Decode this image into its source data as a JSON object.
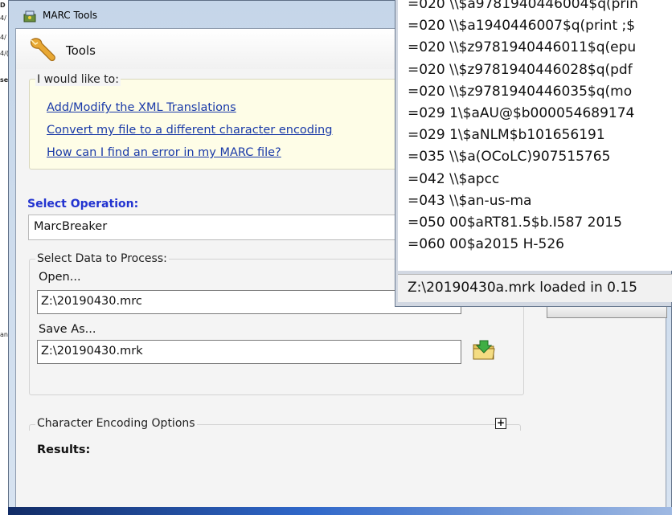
{
  "window": {
    "title": "MARC Tools"
  },
  "header": {
    "title": "Tools"
  },
  "would_like": {
    "legend": "I would like to:",
    "links": [
      "Add/Modify the XML Translations",
      "Convert my file to a different character encoding",
      "How can I find an error in my MARC file?"
    ]
  },
  "operation": {
    "label": "Select Operation:",
    "selected": "MarcBreaker"
  },
  "data": {
    "legend": "Select Data to Process:",
    "open_label": "Open...",
    "open_value": "Z:\\20190430.mrc",
    "save_label": "Save As...",
    "save_value": "Z:\\20190430.mrk"
  },
  "encoding": {
    "legend": "Character Encoding Options",
    "expand_symbol": "+"
  },
  "results": {
    "label": "Results:"
  },
  "record": {
    "lines": [
      "=020  \\\\$a9781940446004$q(prin",
      "=020  \\\\$a1940446007$q(print ;$",
      "=020  \\\\$z9781940446011$q(epu",
      "=020  \\\\$z9781940446028$q(pdf",
      "=020  \\\\$z9781940446035$q(mo",
      "=029  1\\$aAU@$b000054689174",
      "=029  1\\$aNLM$b101656191",
      "=035  \\\\$a(OCoLC)907515765",
      "=042  \\\\$apcc",
      "=043  \\\\$an-us-ma",
      "=050  00$aRT81.5$b.I587 2015",
      "=060  00$a2015 H-526"
    ],
    "status": "Z:\\20190430a.mrk loaded in 0.15"
  },
  "background": {
    "left_fragments": [
      "D",
      "4/",
      "4/",
      "4/(",
      "se",
      "an"
    ]
  },
  "colors": {
    "link": "#1a3aa8",
    "operation_label": "#2233d0",
    "info_box": "#fefde7"
  },
  "icons": [
    "tools-icon",
    "wrench-icon",
    "open-folder-icon",
    "expand-icon"
  ]
}
